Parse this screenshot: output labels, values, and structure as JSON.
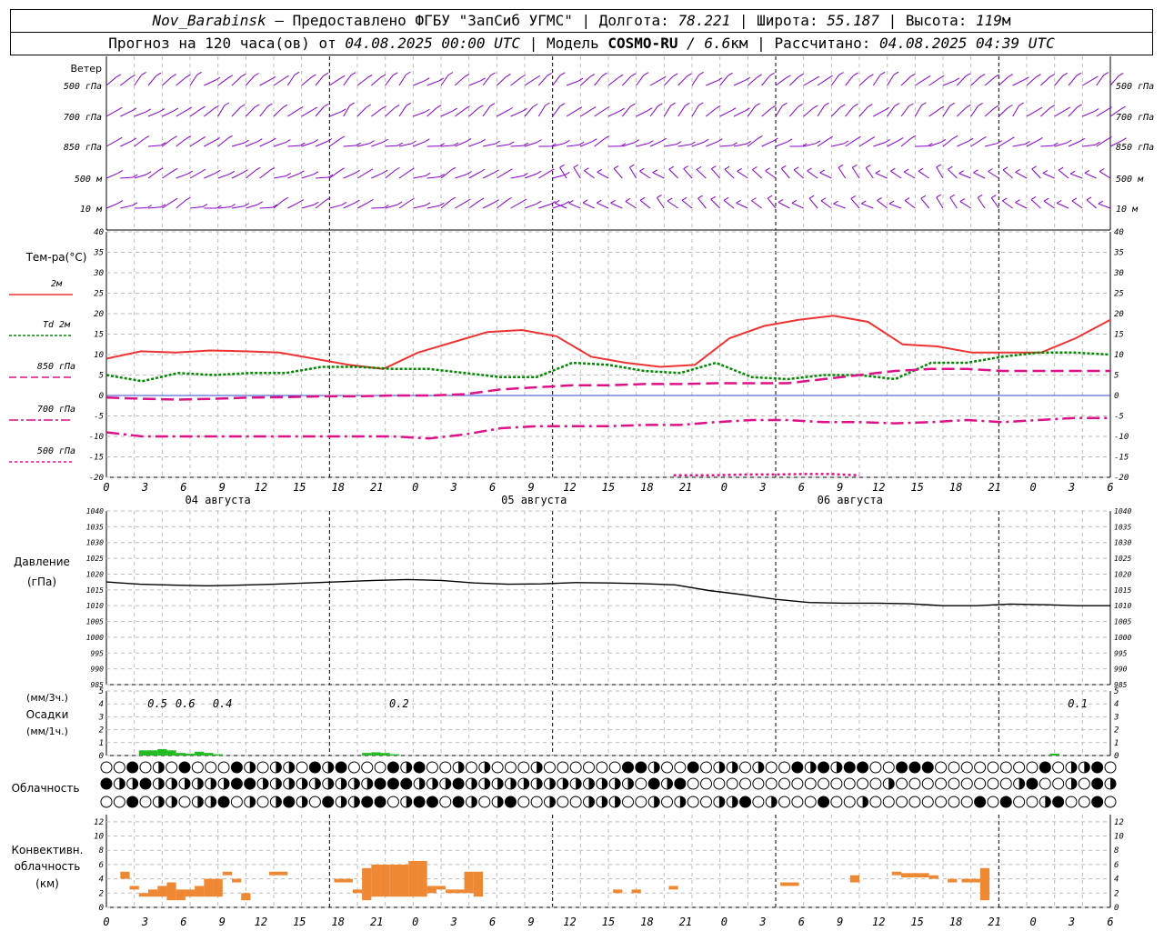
{
  "header": {
    "station": "Nov_Barabinsk",
    "provider": "— Предоставлено ФГБУ \"ЗапСиб УГМС\"",
    "lon_label": "| Долгота:",
    "lon": "78.221",
    "lat_label": "| Широта:",
    "lat": "55.187",
    "alt_label": "| Высота:",
    "alt": "119",
    "alt_unit": "м",
    "fc_label": "Прогноз на 120 часа(ов) от",
    "fc_start": "04.08.2025 00:00 UTC",
    "model_label": "| Модель",
    "model": "COSMO-RU",
    "res": "/ 6.6",
    "res_unit": "км",
    "calc_label": "| Рассчитано:",
    "calc_time": "04.08.2025 04:39 UTC"
  },
  "colors": {
    "wind": "#8800cc",
    "t2m": "#ee3333",
    "td2m": "#008800",
    "t850": "#dd1188",
    "pressure": "#000000",
    "precip": "#22bb22",
    "conv": "#ee8833",
    "grid": "#aaaaaa"
  },
  "x_ticks": [
    "0",
    "3",
    "6",
    "9",
    "12",
    "15",
    "18",
    "21",
    "0",
    "3",
    "6",
    "9",
    "12",
    "15",
    "18",
    "21",
    "0",
    "3",
    "6",
    "9",
    "12",
    "15",
    "18",
    "21",
    "0",
    "3",
    "6"
  ],
  "day_labels": [
    "04 августа",
    "05 августа",
    "06 августа"
  ],
  "wind_panel": {
    "title": "Ветер",
    "levels": [
      "500 гПа",
      "700 гПа",
      "850 гПа",
      "500 м",
      "10  м"
    ],
    "levels_right": [
      "500 гПа",
      "700 гПа",
      "850 гПа",
      "500 м",
      "10  м"
    ]
  },
  "temp_panel": {
    "title": "Тем-ра(°С)",
    "legend": [
      "2м",
      "Td  2м",
      "850 гПа",
      "700 гПа",
      "500 гПа"
    ],
    "yticks": [
      "40",
      "35",
      "30",
      "25",
      "20",
      "15",
      "10",
      "5",
      "0",
      "-5",
      "-10",
      "-15",
      "-20"
    ]
  },
  "pressure_panel": {
    "title": "Давление",
    "unit": "(гПа)",
    "yticks": [
      "1040",
      "1035",
      "1030",
      "1025",
      "1020",
      "1015",
      "1010",
      "1005",
      "1000",
      "995",
      "990",
      "985"
    ]
  },
  "precip_panel": {
    "title_top": "(мм/3ч.)",
    "title": "Осадки",
    "title_bottom": "(мм/1ч.)",
    "yticks": [
      "5",
      "4",
      "3",
      "2",
      "1",
      "0"
    ],
    "annotations": [
      "0.5",
      "0.6",
      "0.4",
      "0.2",
      "0.1"
    ]
  },
  "cloud_panel": {
    "title": "Облачность"
  },
  "conv_panel": {
    "title1": "Конвективн.",
    "title2": "облачность",
    "unit": "(км)",
    "yticks": [
      "12",
      "10",
      "8",
      "6",
      "4",
      "2",
      "0"
    ]
  },
  "chart_data": [
    {
      "type": "line",
      "title": "Тем-ра(°С)",
      "ylim": [
        -20,
        40
      ],
      "x_hours": [
        0,
        3,
        6,
        9,
        12,
        15,
        18,
        21,
        24,
        27,
        30,
        33,
        36,
        39,
        42,
        45,
        48,
        51,
        54,
        57,
        60,
        63,
        66,
        69,
        72,
        75,
        78,
        81,
        84,
        87,
        90,
        93,
        96,
        99,
        102
      ],
      "series": [
        {
          "name": "2м",
          "values": [
            9,
            10.8,
            10.5,
            11,
            10.8,
            10.5,
            9,
            7.5,
            6.5,
            10.5,
            13,
            15.5,
            16,
            14.5,
            9.5,
            8,
            7,
            7.5,
            14,
            17,
            18.5,
            19.5,
            18,
            12.5,
            12,
            10.5,
            10.5,
            10.5,
            14,
            18.5
          ]
        },
        {
          "name": "Td  2м",
          "values": [
            5,
            3.5,
            5.5,
            5,
            5.5,
            5.5,
            7,
            7,
            6.5,
            6.5,
            5.5,
            4.5,
            4.5,
            8,
            7.5,
            6,
            5.5,
            8,
            4.5,
            4,
            5,
            5,
            4,
            8,
            8,
            9.5,
            10.5,
            10.5,
            10
          ]
        },
        {
          "name": "850 гПа",
          "values": [
            -0.5,
            -0.8,
            -1,
            -0.8,
            -0.5,
            -0.4,
            -0.2,
            -0.2,
            0,
            0,
            0.3,
            1.5,
            2,
            2.5,
            2.5,
            2.8,
            2.8,
            3,
            3,
            3,
            4,
            5,
            6,
            6.5,
            6.5,
            6,
            6,
            6,
            6
          ]
        },
        {
          "name": "700 гПа",
          "values": [
            -9,
            -10,
            -10,
            -10,
            -10,
            -10,
            -10,
            -10,
            -10,
            -10.5,
            -9.5,
            -8,
            -7.5,
            -7.5,
            -7.5,
            -7.2,
            -7.2,
            -6.5,
            -6,
            -6,
            -6.5,
            -6.5,
            -6.8,
            -6.5,
            -6,
            -6.5,
            -6,
            -5.5,
            -5.5
          ]
        },
        {
          "name": "500 гПа",
          "values": [
            -19.5,
            -19.5,
            -19.3,
            -19.3,
            -19.2,
            -19.2,
            -19.5
          ]
        }
      ]
    },
    {
      "type": "line",
      "title": "Давление",
      "ylim": [
        985,
        1040
      ],
      "x_hours": [
        0,
        3,
        6,
        9,
        12,
        15,
        18,
        21,
        24,
        27,
        30,
        33,
        36,
        39,
        42,
        45,
        48,
        51,
        54,
        57,
        60,
        63,
        66,
        69,
        72,
        75,
        78,
        81,
        84,
        87,
        90,
        93,
        96
      ],
      "series": [
        {
          "name": "Давление",
          "values": [
            1017.5,
            1016.8,
            1016.5,
            1016.3,
            1016.5,
            1016.8,
            1017.2,
            1017.6,
            1018,
            1018.3,
            1018,
            1017.2,
            1016.8,
            1016.9,
            1017.3,
            1017.2,
            1017,
            1016.6,
            1014.8,
            1013.5,
            1012,
            1011,
            1010.8,
            1010.8,
            1010.6,
            1010,
            1010,
            1010.5,
            1010.3,
            1010,
            1010
          ]
        }
      ]
    },
    {
      "type": "bar",
      "title": "Осадки",
      "ylim": [
        0,
        5
      ],
      "x_hours": [
        4,
        5,
        6,
        7,
        8,
        9,
        10,
        11,
        12,
        28,
        29,
        30,
        31,
        102
      ],
      "values": [
        0.4,
        0.4,
        0.5,
        0.4,
        0.2,
        0.15,
        0.3,
        0.2,
        0.1,
        0.2,
        0.25,
        0.2,
        0.1,
        0.15
      ]
    },
    {
      "type": "bar",
      "title": "Конвективн. облачность",
      "ylim": [
        0,
        13
      ],
      "segments": [
        [
          1.5,
          2.5,
          4,
          5
        ],
        [
          2.5,
          3.5,
          2.5,
          3
        ],
        [
          3.5,
          4.5,
          1.5,
          2
        ],
        [
          4.5,
          5.5,
          1.5,
          2.5
        ],
        [
          5.5,
          6.5,
          1.5,
          3
        ],
        [
          6.5,
          7.5,
          1,
          3.5
        ],
        [
          7.5,
          8.5,
          1,
          2.5
        ],
        [
          8.5,
          9.5,
          1.5,
          2.5
        ],
        [
          9.5,
          10.5,
          1.5,
          3
        ],
        [
          10.5,
          11.5,
          1.5,
          4
        ],
        [
          11.5,
          12.5,
          1.5,
          4
        ],
        [
          12.5,
          13.5,
          4.5,
          5
        ],
        [
          13.5,
          14.5,
          3.5,
          4
        ],
        [
          14.5,
          15.5,
          1,
          2
        ],
        [
          17.5,
          19.5,
          4.5,
          5
        ],
        [
          24.5,
          26.5,
          3.5,
          4
        ],
        [
          26.5,
          27.5,
          2,
          2.5
        ],
        [
          27.5,
          28.5,
          1,
          5.5
        ],
        [
          28.5,
          29.5,
          1.5,
          6
        ],
        [
          29.5,
          30.5,
          1.5,
          6
        ],
        [
          30.5,
          31.5,
          1.5,
          6
        ],
        [
          31.5,
          32.5,
          1.5,
          6
        ],
        [
          32.5,
          33.5,
          1.5,
          6.5
        ],
        [
          33.5,
          34.5,
          1.5,
          6.5
        ],
        [
          34.5,
          35.5,
          2,
          3
        ],
        [
          35.5,
          36.5,
          2.5,
          3
        ],
        [
          36.5,
          37.5,
          2,
          2.5
        ],
        [
          37.5,
          38.5,
          2,
          2.5
        ],
        [
          38.5,
          39.5,
          2,
          5
        ],
        [
          39.5,
          40.5,
          1.5,
          5
        ],
        [
          54.5,
          55.5,
          2,
          2.5
        ],
        [
          56.5,
          57.5,
          2,
          2.5
        ],
        [
          60.5,
          61.5,
          2.5,
          3
        ],
        [
          72.5,
          74.5,
          3,
          3.5
        ],
        [
          80,
          81,
          3.5,
          4.5
        ],
        [
          84.5,
          85.5,
          4.5,
          5
        ],
        [
          85.5,
          88.5,
          4.2,
          4.8
        ],
        [
          88.5,
          89.5,
          4,
          4.5
        ],
        [
          90.5,
          91.5,
          3.5,
          4
        ],
        [
          92,
          93,
          3.5,
          4
        ],
        [
          93,
          94,
          3.5,
          4
        ],
        [
          94,
          95,
          1,
          5.5
        ]
      ]
    }
  ]
}
